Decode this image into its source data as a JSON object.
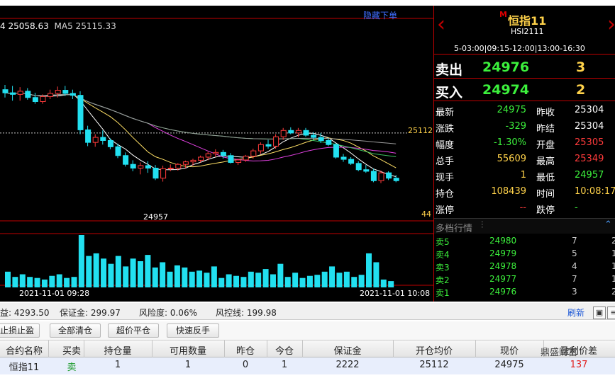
{
  "chart": {
    "hide_order_label": "隐藏下单",
    "ma_row_prefix": "4 25058.63",
    "ma_row_ma5": "MA5 25115.33",
    "price_line_label": "25112",
    "price_small_label": "44",
    "low_label": "24957",
    "time_start": "2021-11-01 09:28",
    "time_end": "2021-11-01 10:08",
    "colors": {
      "up": "#ff3b3b",
      "down": "#22e0f0",
      "ma_white": "#ffffff",
      "ma_yellow": "#ffe066",
      "ma_magenta": "#e040e0",
      "ma_green": "#3cc060",
      "ma_gray": "#9a9a9a"
    }
  },
  "chart_data": {
    "type": "candlestick",
    "ylim": [
      24850,
      25450
    ],
    "price_line": 25112,
    "candles": [
      {
        "o": 25250,
        "h": 25265,
        "l": 25225,
        "c": 25240
      },
      {
        "o": 25240,
        "h": 25262,
        "l": 25215,
        "c": 25235
      },
      {
        "o": 25235,
        "h": 25258,
        "l": 25215,
        "c": 25245
      },
      {
        "o": 25245,
        "h": 25255,
        "l": 25218,
        "c": 25225
      },
      {
        "o": 25225,
        "h": 25240,
        "l": 25205,
        "c": 25212
      },
      {
        "o": 25212,
        "h": 25235,
        "l": 25205,
        "c": 25228
      },
      {
        "o": 25228,
        "h": 25250,
        "l": 25220,
        "c": 25238
      },
      {
        "o": 25238,
        "h": 25260,
        "l": 25225,
        "c": 25248
      },
      {
        "o": 25248,
        "h": 25262,
        "l": 25230,
        "c": 25238
      },
      {
        "o": 25238,
        "h": 25250,
        "l": 25220,
        "c": 25232
      },
      {
        "o": 25232,
        "h": 25245,
        "l": 25108,
        "c": 25122
      },
      {
        "o": 25122,
        "h": 25135,
        "l": 25070,
        "c": 25082
      },
      {
        "o": 25082,
        "h": 25108,
        "l": 25068,
        "c": 25098
      },
      {
        "o": 25098,
        "h": 25120,
        "l": 25075,
        "c": 25088
      },
      {
        "o": 25088,
        "h": 25095,
        "l": 25060,
        "c": 25068
      },
      {
        "o": 25068,
        "h": 25078,
        "l": 25032,
        "c": 25040
      },
      {
        "o": 25040,
        "h": 25050,
        "l": 25005,
        "c": 25012
      },
      {
        "o": 25012,
        "h": 25025,
        "l": 24990,
        "c": 25000
      },
      {
        "o": 25000,
        "h": 25018,
        "l": 24980,
        "c": 25008
      },
      {
        "o": 25008,
        "h": 25022,
        "l": 24985,
        "c": 25000
      },
      {
        "o": 25000,
        "h": 25010,
        "l": 24962,
        "c": 24968
      },
      {
        "o": 24968,
        "h": 25008,
        "l": 24957,
        "c": 24998
      },
      {
        "o": 24998,
        "h": 25012,
        "l": 24990,
        "c": 25000
      },
      {
        "o": 25000,
        "h": 25016,
        "l": 24992,
        "c": 25012
      },
      {
        "o": 25012,
        "h": 25024,
        "l": 25000,
        "c": 25020
      },
      {
        "o": 25020,
        "h": 25030,
        "l": 25008,
        "c": 25025
      },
      {
        "o": 25025,
        "h": 25040,
        "l": 25018,
        "c": 25035
      },
      {
        "o": 25035,
        "h": 25052,
        "l": 25025,
        "c": 25046
      },
      {
        "o": 25046,
        "h": 25060,
        "l": 25035,
        "c": 25050
      },
      {
        "o": 25050,
        "h": 25058,
        "l": 25030,
        "c": 25040
      },
      {
        "o": 25040,
        "h": 25048,
        "l": 25015,
        "c": 25018
      },
      {
        "o": 25018,
        "h": 25030,
        "l": 25010,
        "c": 25026
      },
      {
        "o": 25026,
        "h": 25042,
        "l": 25020,
        "c": 25038
      },
      {
        "o": 25038,
        "h": 25062,
        "l": 25030,
        "c": 25055
      },
      {
        "o": 25055,
        "h": 25082,
        "l": 25045,
        "c": 25075
      },
      {
        "o": 25075,
        "h": 25090,
        "l": 25062,
        "c": 25070
      },
      {
        "o": 25070,
        "h": 25108,
        "l": 25062,
        "c": 25100
      },
      {
        "o": 25100,
        "h": 25128,
        "l": 25090,
        "c": 25120
      },
      {
        "o": 25120,
        "h": 25130,
        "l": 25108,
        "c": 25112
      },
      {
        "o": 25112,
        "h": 25128,
        "l": 25098,
        "c": 25120
      },
      {
        "o": 25120,
        "h": 25128,
        "l": 25100,
        "c": 25105
      },
      {
        "o": 25105,
        "h": 25115,
        "l": 25090,
        "c": 25098
      },
      {
        "o": 25098,
        "h": 25112,
        "l": 25080,
        "c": 25088
      },
      {
        "o": 25088,
        "h": 25095,
        "l": 25070,
        "c": 25075
      },
      {
        "o": 25075,
        "h": 25080,
        "l": 25030,
        "c": 25035
      },
      {
        "o": 25035,
        "h": 25045,
        "l": 25020,
        "c": 25028
      },
      {
        "o": 25028,
        "h": 25035,
        "l": 25010,
        "c": 25015
      },
      {
        "o": 25015,
        "h": 25022,
        "l": 24990,
        "c": 24995
      },
      {
        "o": 24995,
        "h": 25010,
        "l": 24985,
        "c": 24990
      },
      {
        "o": 24990,
        "h": 24998,
        "l": 24955,
        "c": 24960
      },
      {
        "o": 24960,
        "h": 24992,
        "l": 24952,
        "c": 24985
      },
      {
        "o": 24985,
        "h": 24990,
        "l": 24962,
        "c": 24968
      },
      {
        "o": 24968,
        "h": 24978,
        "l": 24955,
        "c": 24960
      }
    ],
    "volumes": [
      30,
      20,
      25,
      20,
      18,
      15,
      22,
      25,
      18,
      20,
      100,
      60,
      65,
      55,
      45,
      60,
      40,
      55,
      50,
      62,
      38,
      48,
      30,
      42,
      38,
      30,
      32,
      28,
      40,
      18,
      25,
      22,
      20,
      30,
      28,
      35,
      25,
      45,
      20,
      28,
      18,
      22,
      24,
      30,
      40,
      28,
      30,
      20,
      24,
      65,
      48,
      15,
      12
    ]
  },
  "quote": {
    "name": "恒指11",
    "m_badge": "M",
    "code": "HSI2111",
    "session": "5-03:00|09:15-12:00|13:00-16:30",
    "sell_label": "卖出",
    "sell_price": "24976",
    "sell_vol": "3",
    "buy_label": "买入",
    "buy_price": "24974",
    "buy_vol": "2",
    "stats": [
      {
        "l1": "最新",
        "v1": "24975",
        "c1": "g",
        "l2": "昨收",
        "v2": "25304",
        "c2": "lab"
      },
      {
        "l1": "涨跌",
        "v1": "-329",
        "c1": "g",
        "l2": "昨结",
        "v2": "25304",
        "c2": "lab"
      },
      {
        "l1": "幅度",
        "v1": "-1.30%",
        "c1": "g",
        "l2": "开盘",
        "v2": "25305",
        "c2": "r"
      },
      {
        "l1": "总手",
        "v1": "55609",
        "c1": "y",
        "l2": "最高",
        "v2": "25349",
        "c2": "r"
      },
      {
        "l1": "现手",
        "v1": "1",
        "c1": "y",
        "l2": "最低",
        "v2": "24957",
        "c2": "g"
      },
      {
        "l1": "持仓",
        "v1": "108439",
        "c1": "y",
        "l2": "时间",
        "v2": "10:08:17",
        "c2": "y"
      },
      {
        "l1": "涨停",
        "v1": "--",
        "c1": "r",
        "l2": "跌停",
        "v2": "-",
        "c2": "g"
      }
    ],
    "depth_title": "多档行情",
    "depth": [
      {
        "label": "卖5",
        "price": "24980",
        "vol": "7",
        "extra": "2"
      },
      {
        "label": "卖4",
        "price": "24979",
        "vol": "5",
        "extra": "1"
      },
      {
        "label": "卖3",
        "price": "24978",
        "vol": "4",
        "extra": "1"
      },
      {
        "label": "卖2",
        "price": "24977",
        "vol": "7",
        "extra": "1"
      },
      {
        "label": "卖1",
        "price": "24976",
        "vol": "3",
        "extra": "2"
      }
    ]
  },
  "account": {
    "equity": "益: 4293.50",
    "margin": "保证金: 299.97",
    "risk": "风险度: 0.06%",
    "control": "风控线: 199.98",
    "refresh": "刷新"
  },
  "buttons": {
    "stop": "止损止盈",
    "close_all": "全部清仓",
    "over_close": "超价平仓",
    "reverse": "快速反手"
  },
  "table": {
    "headers": [
      "合约名称",
      "买卖",
      "持仓量",
      "可用数量",
      "昨仓",
      "今仓",
      "保证金",
      "开仓均价",
      "现价",
      "盈利价差"
    ],
    "row": [
      "恒指11",
      "卖",
      "1",
      "1",
      "0",
      "1",
      "2222",
      "25112",
      "24975",
      "137"
    ]
  },
  "watermark": "鼎盛财富"
}
